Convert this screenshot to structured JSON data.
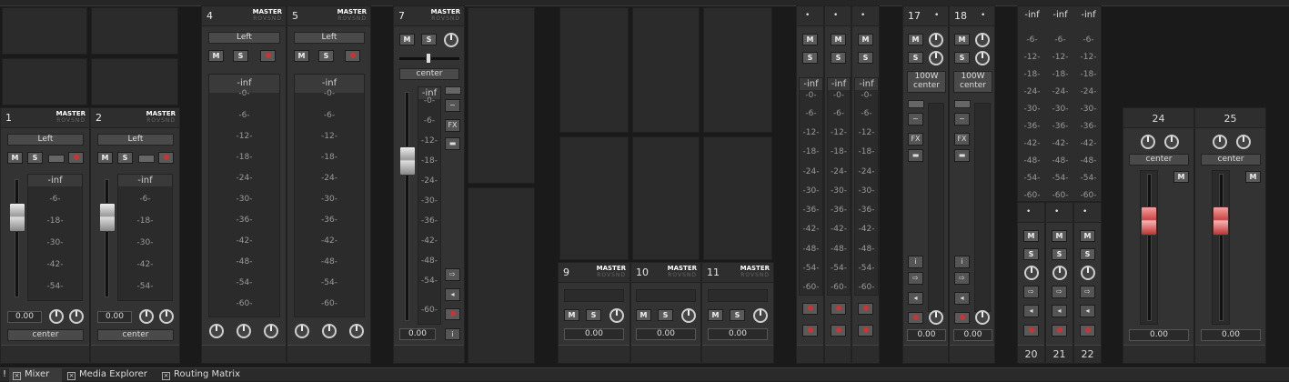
{
  "tabs": [
    {
      "label": "Mixer"
    },
    {
      "label": "Media Explorer"
    },
    {
      "label": "Routing Matrix"
    }
  ],
  "bang": "!",
  "labels": {
    "master": "MASTER",
    "sub": "ROVSND",
    "mute": "M",
    "solo": "S",
    "fx": "FX",
    "trim": "100W",
    "center": "center",
    "left": "Left",
    "inf": "-inf",
    "zero": "0.00"
  },
  "scales": {
    "short": [
      "-6-",
      "-18-",
      "-30-",
      "-42-",
      "-54-"
    ],
    "mid": [
      "-0-",
      "-6-",
      "-12-",
      "-18-",
      "-24-",
      "-30-",
      "-36-",
      "-42-",
      "-48-",
      "-54-",
      "-60-"
    ],
    "long": [
      "-0-",
      "-6-",
      "-12-",
      "-18-",
      "-24-",
      "-30-",
      "-36-",
      "-42-",
      "-48-",
      "-54-",
      "-60-"
    ],
    "bus": [
      "-6-",
      "-12-",
      "-18-",
      "-24-",
      "-30-",
      "-36-",
      "-42-",
      "-48-",
      "-54-",
      "-60-"
    ]
  },
  "tracks": [
    {
      "n": "1",
      "pan": "Left",
      "vol": "0.00"
    },
    {
      "n": "2",
      "pan": "Left",
      "vol": "0.00"
    },
    {
      "n": "4",
      "pan": "Left"
    },
    {
      "n": "5",
      "pan": "Left"
    },
    {
      "n": "7",
      "pan": "center",
      "vol": "0.00"
    },
    {
      "n": "9",
      "vol": "0.00"
    },
    {
      "n": "10",
      "vol": "0.00"
    },
    {
      "n": "11",
      "vol": "0.00"
    },
    {
      "n": "17",
      "vol": "0.00"
    },
    {
      "n": "18",
      "vol": "0.00"
    },
    {
      "n": "20"
    },
    {
      "n": "21"
    },
    {
      "n": "22"
    },
    {
      "n": "24",
      "pan": "center",
      "vol": "0.00"
    },
    {
      "n": "25",
      "pan": "center",
      "vol": "0.00"
    }
  ]
}
